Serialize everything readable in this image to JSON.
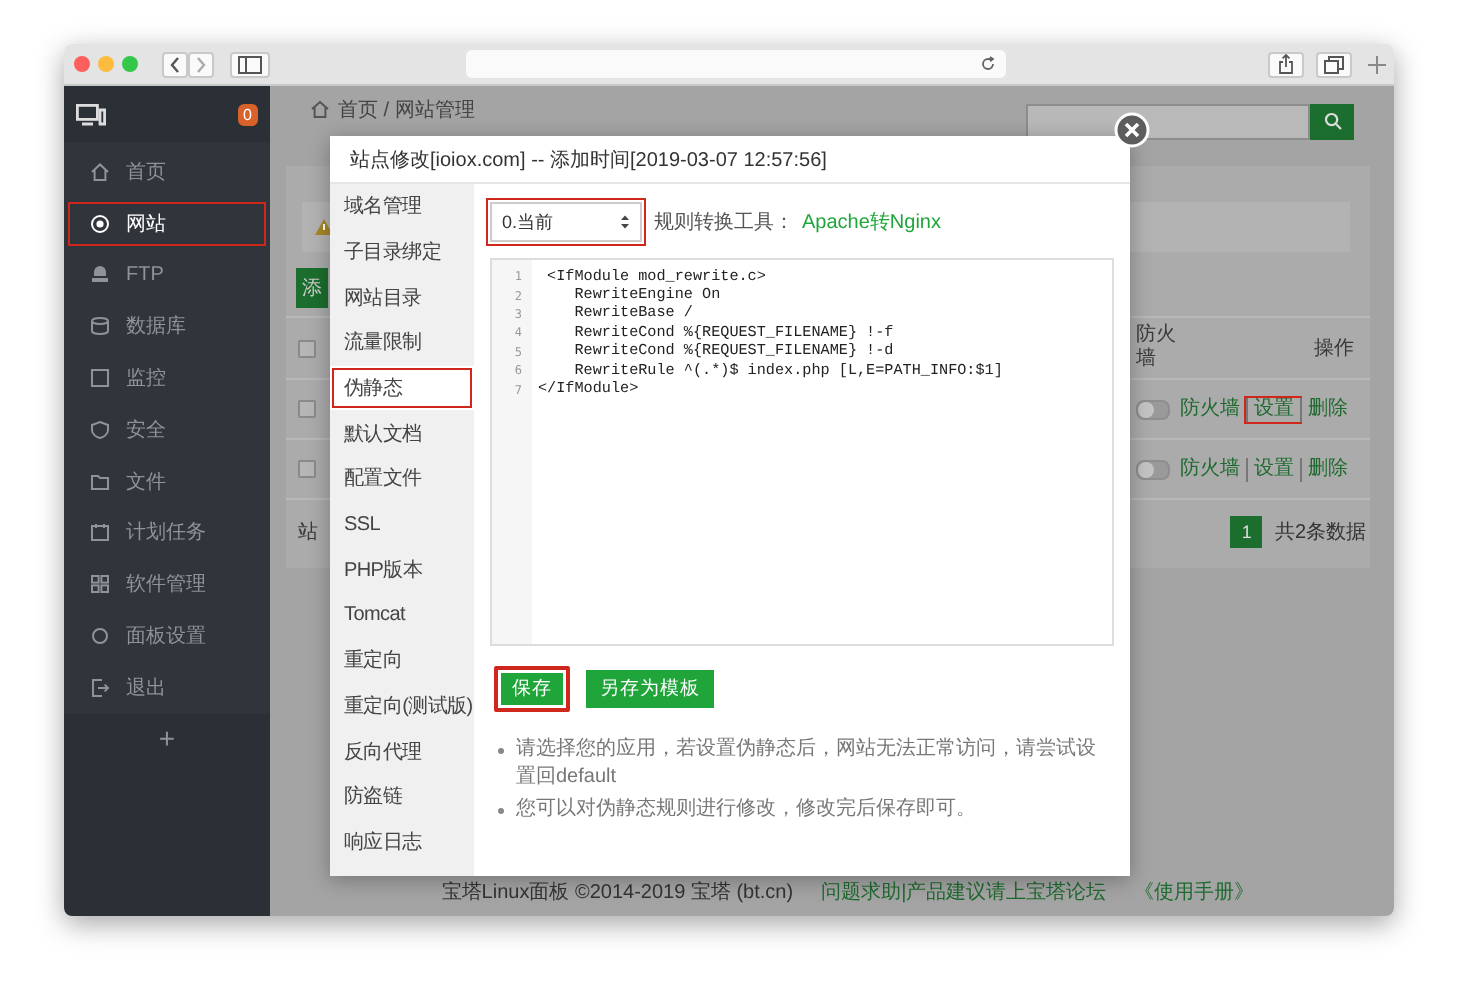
{
  "sidebar": {
    "badge": "0",
    "items": [
      {
        "label": "首页",
        "selected": false
      },
      {
        "label": "网站",
        "selected": true
      },
      {
        "label": "FTP",
        "selected": false
      },
      {
        "label": "数据库",
        "selected": false
      },
      {
        "label": "监控",
        "selected": false
      },
      {
        "label": "安全",
        "selected": false
      },
      {
        "label": "文件",
        "selected": false
      },
      {
        "label": "计划任务",
        "selected": false
      },
      {
        "label": "软件管理",
        "selected": false
      },
      {
        "label": "面板设置",
        "selected": false
      },
      {
        "label": "退出",
        "selected": false
      }
    ],
    "add": "+"
  },
  "breadcrumb": "首页 / 网站管理",
  "site_list": {
    "add_button": "添",
    "select_all_checked": false,
    "columns": [
      "防火墙",
      "操作"
    ],
    "rows": [
      {
        "checked": false,
        "firewall_on": false,
        "actions": [
          {
            "label": "防火墙",
            "highlight": false
          },
          {
            "label": "设置",
            "highlight": true
          },
          {
            "label": "删除",
            "highlight": false
          }
        ]
      },
      {
        "checked": false,
        "firewall_on": false,
        "actions": [
          {
            "label": "防火墙",
            "highlight": false
          },
          {
            "label": "设置",
            "highlight": false
          },
          {
            "label": "删除",
            "highlight": false
          }
        ]
      }
    ],
    "footer_text": "站",
    "pagination": {
      "pages": [
        {
          "label": "1",
          "selected": true
        }
      ],
      "total": "共2条数据"
    }
  },
  "modal": {
    "title": "站点修改[ioiox.com] -- 添加时间[2019-03-07 12:57:56]",
    "tabs": [
      {
        "label": "域名管理",
        "selected": false
      },
      {
        "label": "子目录绑定",
        "selected": false
      },
      {
        "label": "网站目录",
        "selected": false
      },
      {
        "label": "流量限制",
        "selected": false
      },
      {
        "label": "伪静态",
        "selected": true
      },
      {
        "label": "默认文档",
        "selected": false
      },
      {
        "label": "配置文件",
        "selected": false
      },
      {
        "label": "SSL",
        "selected": false
      },
      {
        "label": "PHP版本",
        "selected": false
      },
      {
        "label": "Tomcat",
        "selected": false
      },
      {
        "label": "重定向",
        "selected": false
      },
      {
        "label": "重定向(测试版)",
        "selected": false
      },
      {
        "label": "反向代理",
        "selected": false
      },
      {
        "label": "防盗链",
        "selected": false
      },
      {
        "label": "响应日志",
        "selected": false
      }
    ],
    "template": {
      "value": "0.当前",
      "highlight": true
    },
    "tool_label": "规则转换工具：",
    "tool_link": "Apache转Nginx",
    "code": [
      {
        "number": "1",
        "text": " <IfModule mod_rewrite.c>"
      },
      {
        "number": "2",
        "text": "    RewriteEngine On"
      },
      {
        "number": "3",
        "text": "    RewriteBase /"
      },
      {
        "number": "4",
        "text": "    RewriteCond %{REQUEST_FILENAME} !-f"
      },
      {
        "number": "5",
        "text": "    RewriteCond %{REQUEST_FILENAME} !-d"
      },
      {
        "number": "6",
        "text": "    RewriteRule ^(.*)$ index.php [L,E=PATH_INFO:$1]"
      },
      {
        "number": "7",
        "text": "</IfModule>"
      }
    ],
    "buttons": [
      {
        "label": "保存",
        "highlight": true
      },
      {
        "label": "另存为模板",
        "highlight": false
      }
    ],
    "tips": [
      "请选择您的应用，若设置伪静态后，网站无法正常访问，请尝试设置回default",
      "您可以对伪静态规则进行修改，修改完后保存即可。"
    ]
  },
  "footer": {
    "copyright": "宝塔Linux面板 ©2014-2019 宝塔 (bt.cn)",
    "links": [
      "问题求助|产品建议请上宝塔论坛",
      "《使用手册》"
    ]
  }
}
